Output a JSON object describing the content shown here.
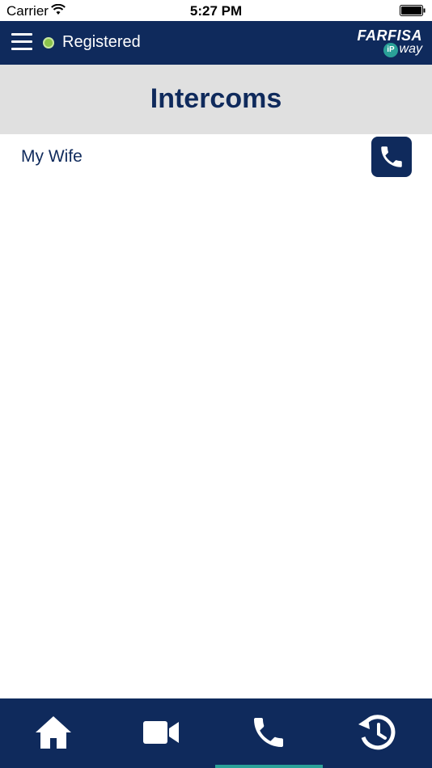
{
  "status_bar": {
    "carrier": "Carrier",
    "time": "5:27 PM"
  },
  "header": {
    "registration_status": "Registered",
    "status_color": "#8bc34a",
    "logo": {
      "brand": "FARFISA",
      "ip": "iP",
      "way": "way"
    }
  },
  "page": {
    "title": "Intercoms"
  },
  "intercoms": [
    {
      "name": "My Wife",
      "action_icon": "phone-icon"
    }
  ],
  "tab_bar": {
    "tabs": [
      {
        "icon": "home-icon",
        "active": false
      },
      {
        "icon": "video-camera-icon",
        "active": false
      },
      {
        "icon": "phone-icon",
        "active": true
      },
      {
        "icon": "history-icon",
        "active": false
      }
    ]
  },
  "colors": {
    "primary": "#0f2a5c",
    "accent": "#2aa198",
    "title_band": "#e0e0e0"
  }
}
